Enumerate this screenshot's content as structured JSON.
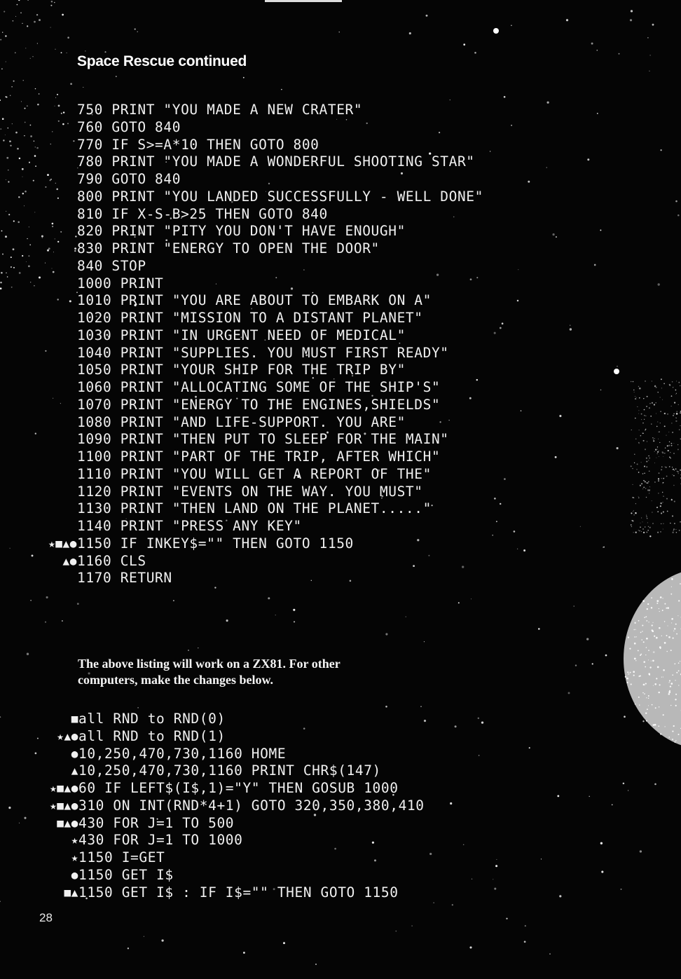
{
  "header": {
    "title": "Space Rescue continued"
  },
  "listing": [
    {
      "markers": "",
      "text": "750 PRINT \"YOU MADE A NEW CRATER\""
    },
    {
      "markers": "",
      "text": "760 GOTO 840"
    },
    {
      "markers": "",
      "text": "770 IF S>=A*10 THEN GOTO 800"
    },
    {
      "markers": "",
      "text": "780 PRINT \"YOU MADE A WONDERFUL SHOOTING STAR\""
    },
    {
      "markers": "",
      "text": "790 GOTO 840"
    },
    {
      "markers": "",
      "text": "800 PRINT \"YOU LANDED SUCCESSFULLY - WELL DONE\""
    },
    {
      "markers": "",
      "text": "810 IF X-S-B>25 THEN GOTO 840"
    },
    {
      "markers": "",
      "text": "820 PRINT \"PITY YOU DON'T HAVE ENOUGH\""
    },
    {
      "markers": "",
      "text": "830 PRINT \"ENERGY TO OPEN THE DOOR\""
    },
    {
      "markers": "",
      "text": "840 STOP"
    },
    {
      "markers": "",
      "text": "1000 PRINT"
    },
    {
      "markers": "",
      "text": "1010 PRINT \"YOU ARE ABOUT TO EMBARK ON A\""
    },
    {
      "markers": "",
      "text": "1020 PRINT \"MISSION TO A DISTANT PLANET\""
    },
    {
      "markers": "",
      "text": "1030 PRINT \"IN URGENT NEED OF MEDICAL\""
    },
    {
      "markers": "",
      "text": "1040 PRINT \"SUPPLIES. YOU MUST FIRST READY\""
    },
    {
      "markers": "",
      "text": "1050 PRINT \"YOUR SHIP FOR THE TRIP BY\""
    },
    {
      "markers": "",
      "text": "1060 PRINT \"ALLOCATING SOME OF THE SHIP'S\""
    },
    {
      "markers": "",
      "text": "1070 PRINT \"ENERGY TO THE ENGINES,SHIELDS\""
    },
    {
      "markers": "",
      "text": "1080 PRINT \"AND LIFE-SUPPORT. YOU ARE\""
    },
    {
      "markers": "",
      "text": "1090 PRINT \"THEN PUT TO SLEEP FOR THE MAIN\""
    },
    {
      "markers": "",
      "text": "1100 PRINT \"PART OF THE TRIP, AFTER WHICH\""
    },
    {
      "markers": "",
      "text": "1110 PRINT \"YOU WILL GET A REPORT OF THE\""
    },
    {
      "markers": "",
      "text": "1120 PRINT \"EVENTS ON THE WAY. YOU MUST\""
    },
    {
      "markers": "",
      "text": "1130 PRINT \"THEN LAND ON THE PLANET.....\""
    },
    {
      "markers": "",
      "text": "1140 PRINT \"PRESS ANY KEY\""
    },
    {
      "markers": "★■▲●",
      "text": "1150 IF INKEY$=\"\" THEN GOTO 1150"
    },
    {
      "markers": "▲●",
      "text": "1160 CLS"
    },
    {
      "markers": "",
      "text": "1170 RETURN"
    }
  ],
  "note": "The above listing will work on a ZX81. For other computers, make the changes below.",
  "changes": [
    {
      "markers": "■",
      "text": "all RND to RND(0)"
    },
    {
      "markers": "★▲●",
      "text": "all RND to RND(1)"
    },
    {
      "markers": "●",
      "text": "10,250,470,730,1160 HOME"
    },
    {
      "markers": "▲",
      "text": "10,250,470,730,1160 PRINT CHR$(147)"
    },
    {
      "markers": "★■▲●",
      "text": "60 IF LEFT$(I$,1)=\"Y\" THEN GOSUB 1000"
    },
    {
      "markers": "★■▲●",
      "text": "310 ON INT(RND*4+1) GOTO 320,350,380,410"
    },
    {
      "markers": "■▲●",
      "text": "430 FOR J=1 TO 500"
    },
    {
      "markers": "★",
      "text": "430 FOR J=1 TO 1000"
    },
    {
      "markers": "★",
      "text": "1150 I=GET"
    },
    {
      "markers": "●",
      "text": "1150 GET I$"
    },
    {
      "markers": "■▲",
      "text": "1150 GET I$ : IF I$=\"\" THEN GOTO 1150"
    }
  ],
  "footer": {
    "page_number": "28"
  }
}
